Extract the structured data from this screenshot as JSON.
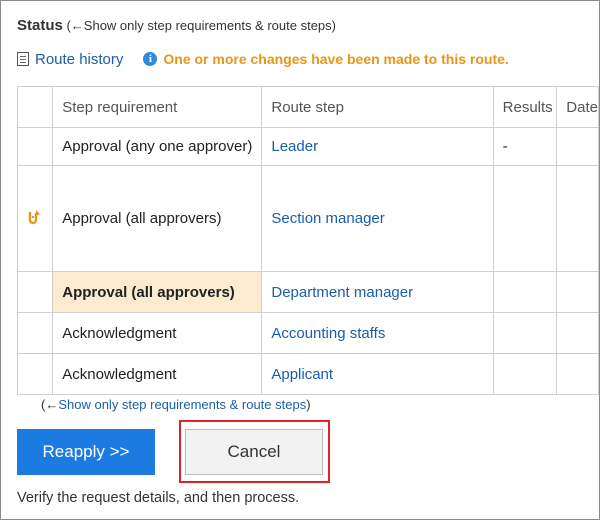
{
  "status": {
    "title": "Status",
    "paren_open": " (←",
    "toggle_link": "Show only step requirements & route steps",
    "paren_close": ")"
  },
  "info": {
    "route_history": "Route history",
    "notice": "One or more changes have been made to this route.",
    "info_glyph": "i"
  },
  "table": {
    "headers": [
      "",
      "Step requirement",
      "Route step",
      "Results",
      "Date"
    ],
    "rows": [
      {
        "marker": "",
        "requirement": "Approval (any one approver)",
        "step": "Leader",
        "results": "-",
        "date": ""
      },
      {
        "marker": "return-icon",
        "requirement": "Approval (all approvers)",
        "step": "Section manager",
        "results": "",
        "date": ""
      },
      {
        "marker": "",
        "requirement": "Approval (all approvers)",
        "step": "Department manager",
        "results": "",
        "date": "",
        "highlight": true
      },
      {
        "marker": "",
        "requirement": "Acknowledgment",
        "step": "Accounting staffs",
        "results": "",
        "date": ""
      },
      {
        "marker": "",
        "requirement": "Acknowledgment",
        "step": "Applicant",
        "results": "",
        "date": ""
      }
    ]
  },
  "bottom_toggle": {
    "paren_open": "(←",
    "link": "Show only step requirements & route steps",
    "paren_close": ")"
  },
  "buttons": {
    "reapply": "Reapply >>",
    "cancel": "Cancel"
  },
  "footer": "Verify the request details, and then process.",
  "colors": {
    "link": "#1a5fa8",
    "notice": "#e8951a",
    "primary_button": "#1c7be0",
    "highlight_cell": "#fdebd0",
    "focus_frame": "#e0232b"
  }
}
